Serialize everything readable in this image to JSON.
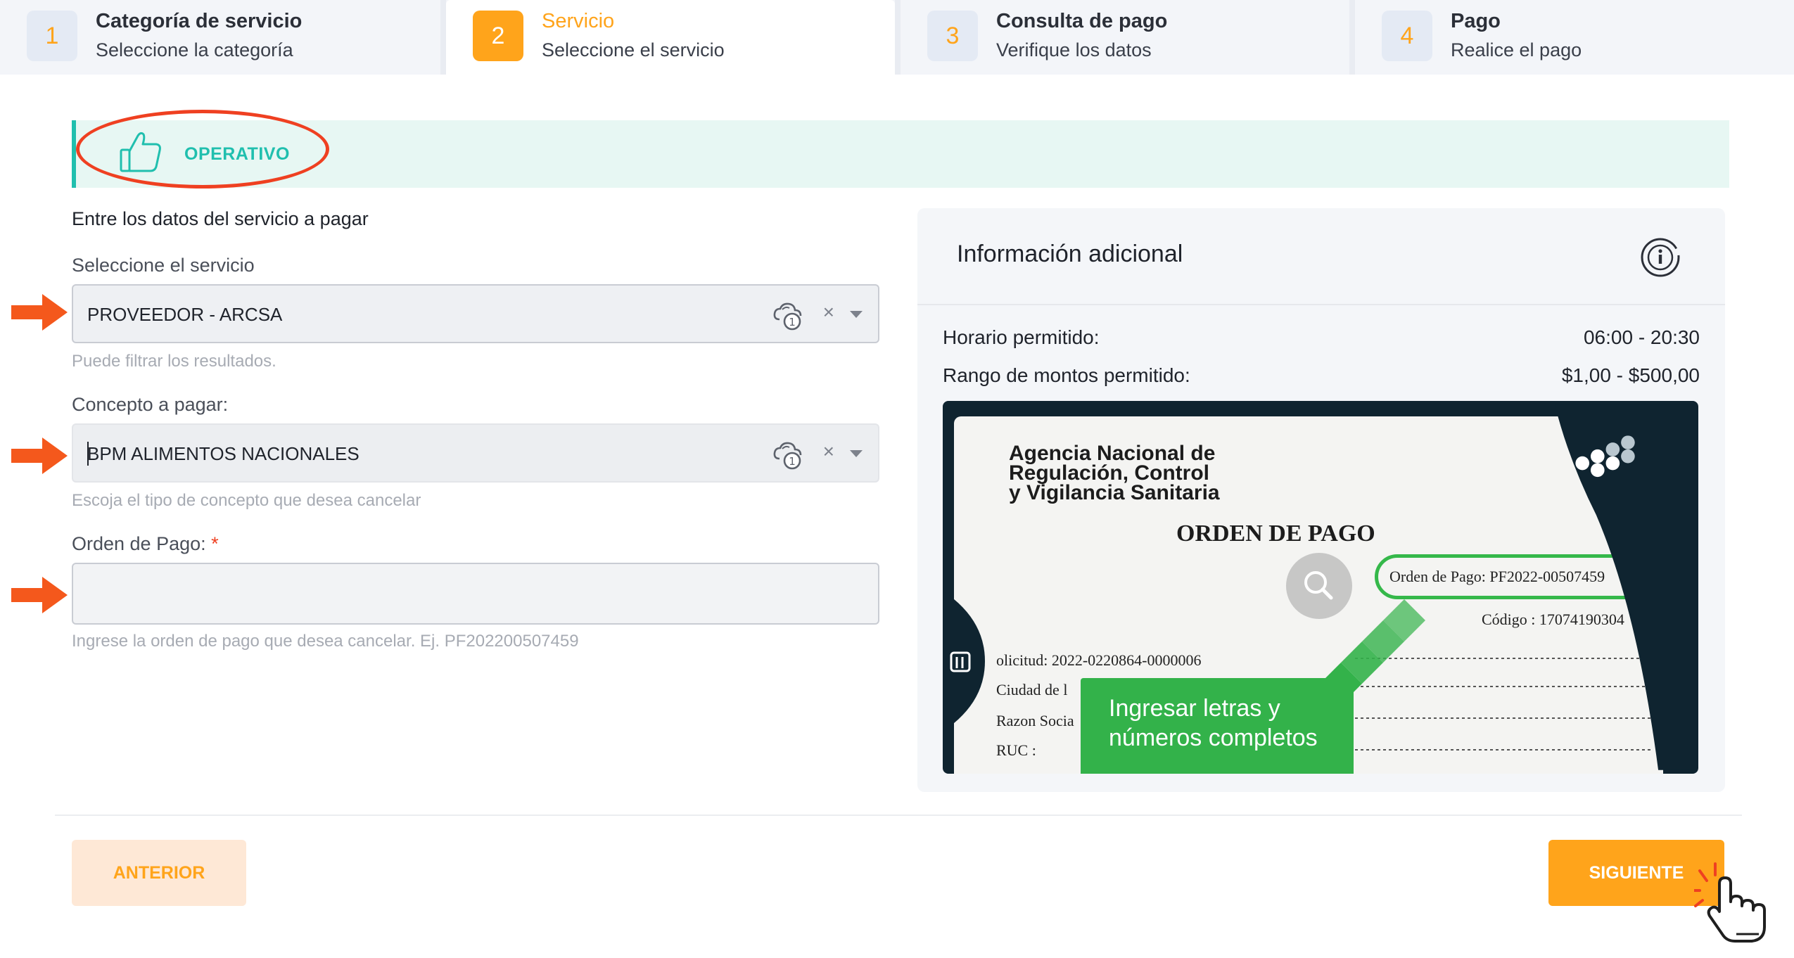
{
  "stepper": {
    "steps": [
      {
        "number": "1",
        "title": "Categoría de servicio",
        "subtitle": "Seleccione la categoría",
        "state": "done"
      },
      {
        "number": "2",
        "title": "Servicio",
        "subtitle": "Seleccione el servicio",
        "state": "active"
      },
      {
        "number": "3",
        "title": "Consulta de pago",
        "subtitle": "Verifique los datos",
        "state": "pending"
      },
      {
        "number": "4",
        "title": "Pago",
        "subtitle": "Realice el pago",
        "state": "pending"
      }
    ]
  },
  "status": {
    "label": "OPERATIVO",
    "icon": "thumbs-up-icon",
    "color": "#20bfae"
  },
  "form": {
    "heading": "Entre los datos del servicio a pagar",
    "service": {
      "label": "Seleccione el servicio",
      "value": "PROVEEDOR - ARCSA",
      "hint": "Puede filtrar los resultados."
    },
    "concept": {
      "label": "Concepto a pagar:",
      "value": "BPM ALIMENTOS NACIONALES",
      "hint": "Escoja el tipo de concepto que desea cancelar"
    },
    "order": {
      "label": "Orden de Pago:",
      "required_mark": "*",
      "value": "",
      "hint": "Ingrese la orden de pago que desea cancelar. Ej. PF202200507459"
    },
    "clear_glyph": "×"
  },
  "info_panel": {
    "title": "Información adicional",
    "schedule_label": "Horario permitido:",
    "schedule_value": "06:00 - 20:30",
    "amount_label": "Rango de montos permitido:",
    "amount_value": "$1,00 - $500,00",
    "sample": {
      "agency_line1": "Agencia Nacional de",
      "agency_line2": "Regulación, Control",
      "agency_line3": "y Vigilancia Sanitaria",
      "doc_title": "ORDEN DE PAGO",
      "order_highlight": "Orden de Pago: PF2022-00507459",
      "code_line": "Código : 17074190304",
      "request_line": "olicitud: 2022-0220864-0000006",
      "city_line": "Ciudad de l",
      "business_line": "Razon Socia",
      "ruc_line": "RUC :",
      "callout": "Ingresar letras y\nnúmeros completos"
    }
  },
  "footer": {
    "prev_label": "ANTERIOR",
    "next_label": "SIGUIENTE"
  },
  "colors": {
    "accent": "#ffa41b",
    "teal": "#20bfae",
    "annotation_red": "#ef4021",
    "callout_green": "#33b24a"
  }
}
